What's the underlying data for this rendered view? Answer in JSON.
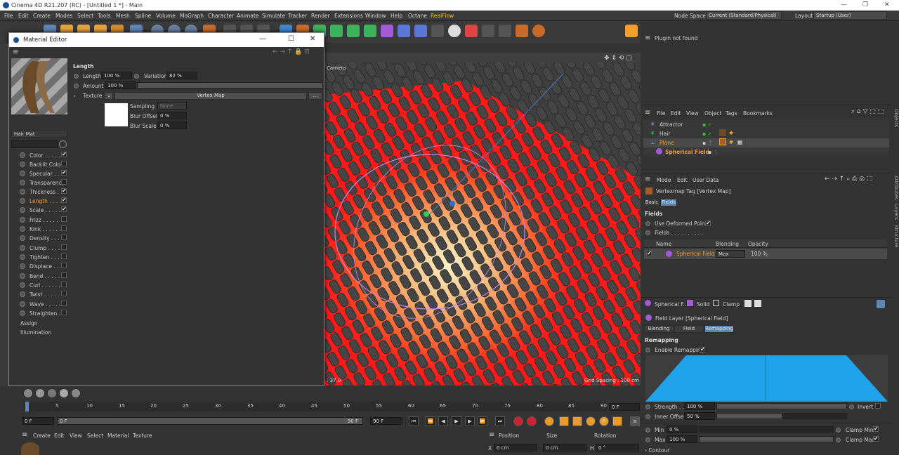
{
  "window": {
    "title": "Cinema 4D R21.207 (RC) - [Untitled 1 *] - Main"
  },
  "menubar": {
    "items": [
      "File",
      "Edit",
      "Create",
      "Modes",
      "Select",
      "Tools",
      "Mesh",
      "Spline",
      "Volume",
      "MoGraph",
      "Character",
      "Animate",
      "Simulate",
      "Tracker",
      "Render",
      "Extensions",
      "Window",
      "Help",
      "Octane",
      "RealFlow"
    ],
    "node_space_label": "Node Space:",
    "node_space_value": "Current (Standard/Physical)",
    "layout_label": "Layout:",
    "layout_value": "Startup (User)"
  },
  "viewport": {
    "camera_label": "Camera",
    "grid_spacing": "Grid Spacing : 100 cm",
    "fps": "37.0"
  },
  "material_editor": {
    "title": "Material Editor",
    "material_name": "Hair Mat",
    "section_title": "Length",
    "length_label": "Length",
    "length_value": "100 %",
    "variation_label": "Variation",
    "variation_value": "82 %",
    "amount_label": "Amount",
    "amount_value": "100 %",
    "texture_label": "Texture",
    "texture_value": "Vertex Map",
    "more_btn": "...",
    "sampling_label": "Sampling",
    "sampling_value": "None",
    "blur_offset_label": "Blur Offset",
    "blur_offset_value": "0 %",
    "blur_scale_label": "Blur Scale",
    "blur_scale_value": "0 %",
    "channels": [
      {
        "label": "Color . . . . .",
        "checked": true
      },
      {
        "label": "Backlit Color",
        "checked": false
      },
      {
        "label": "Specular . . .",
        "checked": true
      },
      {
        "label": "Transparency",
        "checked": false
      },
      {
        "label": "Thickness . .",
        "checked": true
      },
      {
        "label": "Length . . . .",
        "checked": true,
        "active": true
      },
      {
        "label": "Scale . . . . .",
        "checked": true
      },
      {
        "label": "Frizz . . . . .",
        "checked": false
      },
      {
        "label": "Kink . . . . . .",
        "checked": false
      },
      {
        "label": "Density . . . .",
        "checked": false
      },
      {
        "label": "Clump . . . .",
        "checked": false
      },
      {
        "label": "Tighten . . .",
        "checked": false
      },
      {
        "label": "Displace . . .",
        "checked": false
      },
      {
        "label": "Bend . . . . .",
        "checked": false
      },
      {
        "label": "Curl . . . . . .",
        "checked": false
      },
      {
        "label": "Twist . . . . .",
        "checked": false
      },
      {
        "label": "Wave . . . . .",
        "checked": false
      },
      {
        "label": "Straighten . .",
        "checked": false
      }
    ],
    "assign_label": "Assign",
    "illumination_label": "Illumination"
  },
  "right": {
    "plugin_msg": "Plugin not found",
    "om_menu": [
      "File",
      "Edit",
      "View",
      "Object",
      "Tags",
      "Bookmarks"
    ],
    "objects": [
      {
        "name": "Attractor"
      },
      {
        "name": "Hair"
      },
      {
        "name": "Plane",
        "selected": true
      },
      {
        "name": "Spherical Field",
        "child": true
      }
    ],
    "attr_menu": [
      "Mode",
      "Edit",
      "User Data"
    ],
    "attr_title": "Vertexmap Tag [Vertex Map]",
    "tabs1": [
      "Basic",
      "Fields"
    ],
    "fields_heading": "Fields",
    "use_deformed": "Use Deformed Points",
    "fields_label": "Fields . . . . . . . . . .",
    "list_headers": [
      "Name",
      "Blending",
      "Opacity"
    ],
    "list_row": {
      "name": "Spherical Field",
      "blending": "Max",
      "opacity": "100 %"
    },
    "layer_bar": [
      "Spherical F...",
      "Solid",
      "Clamp"
    ],
    "layer_title": "Field Layer [Spherical Field]",
    "tabs2": [
      "Blending",
      "Field",
      "Remapping"
    ],
    "remap_heading": "Remapping",
    "enable_remap": "Enable Remapping",
    "strength_label": "Strength . .",
    "strength_value": "100 %",
    "invert_label": "Invert",
    "inner_offset_label": "Inner Offset",
    "inner_offset_value": "50 %",
    "min_label": "Min",
    "min_value": "0 %",
    "clamp_min": "Clamp Min",
    "max_label": "Max",
    "max_value": "100 %",
    "clamp_max": "Clamp Max",
    "contour_label": "Contour",
    "side_tabs": [
      "Objects",
      "Attributes",
      "Layers",
      "Structure"
    ]
  },
  "timeline": {
    "ticks": [
      "0",
      "5",
      "10",
      "15",
      "20",
      "25",
      "30",
      "35",
      "40",
      "45",
      "50",
      "55",
      "60",
      "65",
      "70",
      "75",
      "80",
      "85",
      "90"
    ],
    "end_frame": "0 F",
    "start_field": "0 F",
    "current_field": "0 F",
    "max_field": "90 F",
    "max_field2": "90 F"
  },
  "bottom": {
    "menu": [
      "Create",
      "Edit",
      "View",
      "Select",
      "Material",
      "Texture"
    ],
    "coord_headers": [
      "Position",
      "Size",
      "Rotation"
    ],
    "x_label": "X",
    "x_pos": "0 cm",
    "x_size": "0 cm",
    "h_label": "H",
    "h_rot": "0 °"
  },
  "colors": {
    "accent_blue": "#1fa3ea",
    "highlight_orange": "#f2a02a",
    "selected_blue": "#5e86b5",
    "red_mesh": "#ff1a1a"
  }
}
